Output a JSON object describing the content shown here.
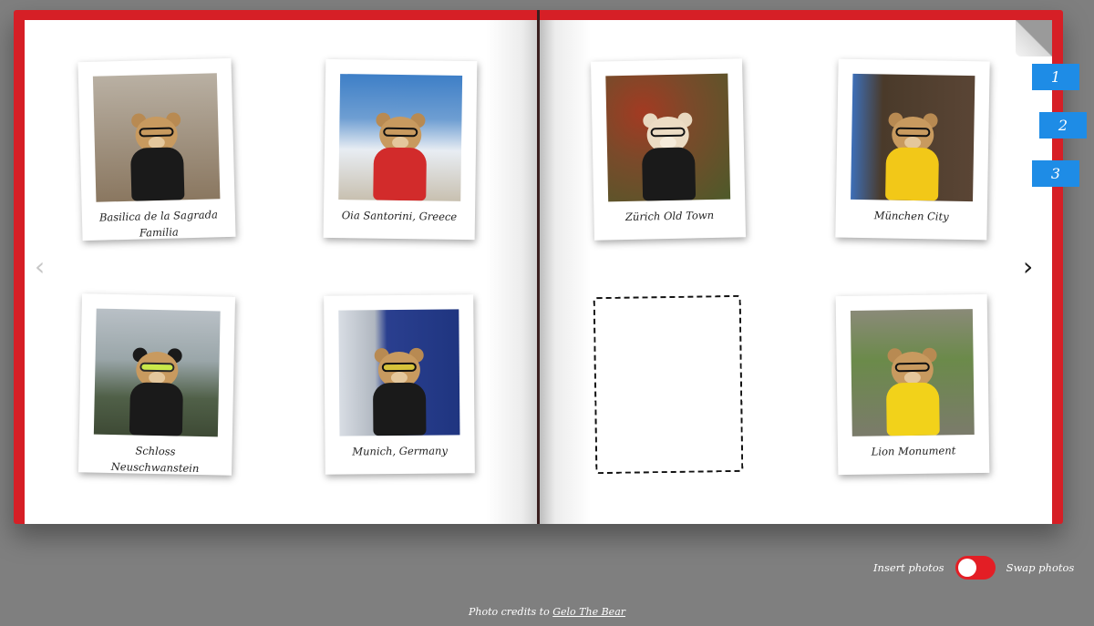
{
  "left_page": {
    "photos": [
      {
        "caption": "Basilica de la Sagrada Familia",
        "scene": "#8a7760",
        "sky": "#b9b0a3",
        "jacket": "#1a1a1a"
      },
      {
        "caption": "Oia Santorini, Greece",
        "scene": "#e8edf3",
        "sky": "#3e7fc7",
        "jacket": "#d22b2b"
      },
      {
        "caption": "Schloss Neuschwanstein",
        "scene": "#506048",
        "sky": "#b9c0c6",
        "jacket": "#1a1a1a"
      },
      {
        "caption": "Munich, Germany",
        "scene": "#2a3f8f",
        "sky": "#d8dde4",
        "jacket": "#1a1a1a"
      }
    ]
  },
  "right_page": {
    "photos": [
      {
        "caption": "Zürich Old Town",
        "scene": "#6b4a2a",
        "sky": "#a33a22",
        "jacket": "#1a1a1a"
      },
      {
        "caption": "München City",
        "scene": "#4a3a2a",
        "sky": "#3d6fb8",
        "jacket": "#f2c818"
      },
      {
        "caption": "Lion Monument",
        "scene": "#7b7b6b",
        "sky": "#6b8a4a",
        "jacket": "#f2d21a"
      }
    ]
  },
  "page_tabs": [
    "1",
    "2",
    "3"
  ],
  "navigation": {
    "prev_icon": "‹",
    "next_icon": "›"
  },
  "toggle": {
    "left_label": "Insert photos",
    "right_label": "Swap photos",
    "state": "swap"
  },
  "credits": {
    "prefix": "Photo credits to",
    "link_text": "Gelo The Bear"
  },
  "colors": {
    "book": "#d61f26",
    "tab": "#1e8ce6",
    "toggle": "#e31e25",
    "background": "#7f7f7f"
  }
}
